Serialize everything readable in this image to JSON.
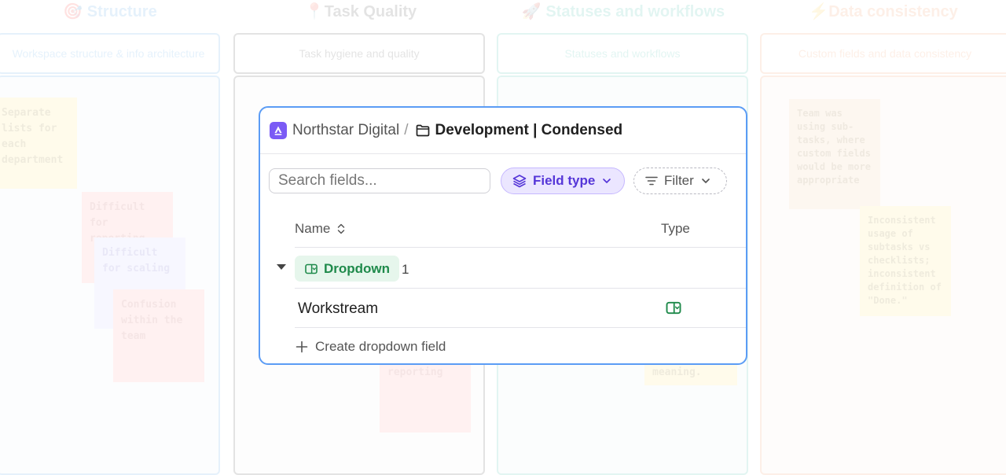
{
  "background": {
    "columns": [
      {
        "heading": "Structure",
        "emoji": "🎯",
        "subheading": "Workspace structure & info architecture",
        "color": "#3f9de8"
      },
      {
        "heading": "Task Quality",
        "emoji": "📍",
        "subheading": "Task hygiene and quality",
        "color": "#333333"
      },
      {
        "heading": "Statuses and workflows",
        "emoji": "🚀",
        "subheading": "Statuses and workflows",
        "color": "#2cb7a0"
      },
      {
        "heading": "Data consistency",
        "emoji": "⚡",
        "subheading": "Custom fields and data consistency",
        "color": "#f08a4b"
      }
    ],
    "notes": [
      "Separate lists for each department",
      "Difficult for reporting",
      "Difficult for scaling",
      "Confusion within the team",
      "reporting",
      "meaning.",
      "Team was using sub-tasks, where custom fields would be more appropriate",
      "Inconsistent usage of subtasks vs checklists; inconsistent definition of \"Done.\""
    ]
  },
  "panel": {
    "breadcrumb": {
      "workspace": "Northstar Digital",
      "separator": "/",
      "list": "Development | Condensed"
    },
    "toolbar": {
      "search_placeholder": "Search fields...",
      "field_type_label": "Field type",
      "filter_label": "Filter"
    },
    "columns": {
      "name": "Name",
      "type": "Type"
    },
    "group": {
      "label": "Dropdown",
      "count": "1"
    },
    "fields": [
      {
        "name": "Workstream",
        "type_icon": "dropdown-field-icon"
      }
    ],
    "create_label": "Create dropdown field"
  },
  "colors": {
    "accent_purple": "#5536d8",
    "panel_border": "#5b9cf5",
    "dropdown_green": "#1f8a4b"
  }
}
